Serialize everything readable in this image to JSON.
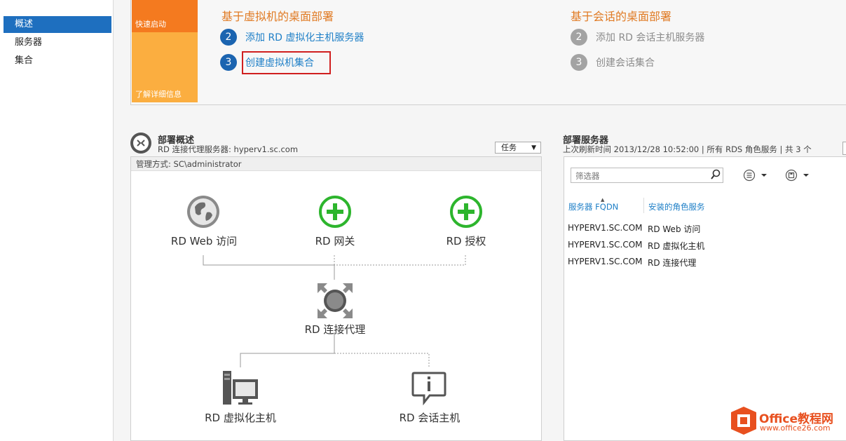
{
  "nav": {
    "items": [
      {
        "label": "概述",
        "active": true
      },
      {
        "label": "服务器",
        "active": false
      },
      {
        "label": "集合",
        "active": false
      }
    ]
  },
  "quick_start": {
    "tile_top_label": "快速启动",
    "tile_bottom_label": "了解详细信息",
    "vm_section": {
      "heading": "基于虚拟机的桌面部署",
      "steps": [
        {
          "number": "2",
          "label": "添加 RD 虚拟化主机服务器"
        },
        {
          "number": "3",
          "label": "创建虚拟机集合"
        }
      ]
    },
    "session_section": {
      "heading": "基于会话的桌面部署",
      "steps": [
        {
          "number": "2",
          "label": "添加 RD 会话主机服务器"
        },
        {
          "number": "3",
          "label": "创建会话集合"
        }
      ]
    }
  },
  "overview": {
    "title": "部署概述",
    "subtitle": "RD 连接代理服务器: hyperv1.sc.com",
    "tasks_label": "任务",
    "managed_by": "管理方式: SC\\administrator",
    "roles": {
      "web_access": "RD Web 访问",
      "gateway": "RD 网关",
      "licensing": "RD 授权",
      "broker": "RD 连接代理",
      "virtualization_host": "RD 虚拟化主机",
      "session_host": "RD 会话主机"
    }
  },
  "servers": {
    "title": "部署服务器",
    "subtitle": "上次刷新时间 2013/12/28 10:52:00 | 所有 RDS 角色服务  | 共 3 个",
    "filter_placeholder": "筛选器",
    "columns": [
      "服务器 FQDN",
      "安装的角色服务"
    ],
    "rows": [
      [
        "HYPERV1.SC.COM",
        "RD Web 访问"
      ],
      [
        "HYPERV1.SC.COM",
        "RD 虚拟化主机"
      ],
      [
        "HYPERV1.SC.COM",
        "RD 连接代理"
      ]
    ]
  },
  "watermark": {
    "brand": "Office教程网",
    "url": "www.office26.com"
  },
  "colors": {
    "accent_blue": "#1e6fbf",
    "orange": "#f47a1f",
    "light_orange": "#fbae40",
    "plus_green": "#2db52d",
    "highlight_red": "#d01f1f"
  }
}
